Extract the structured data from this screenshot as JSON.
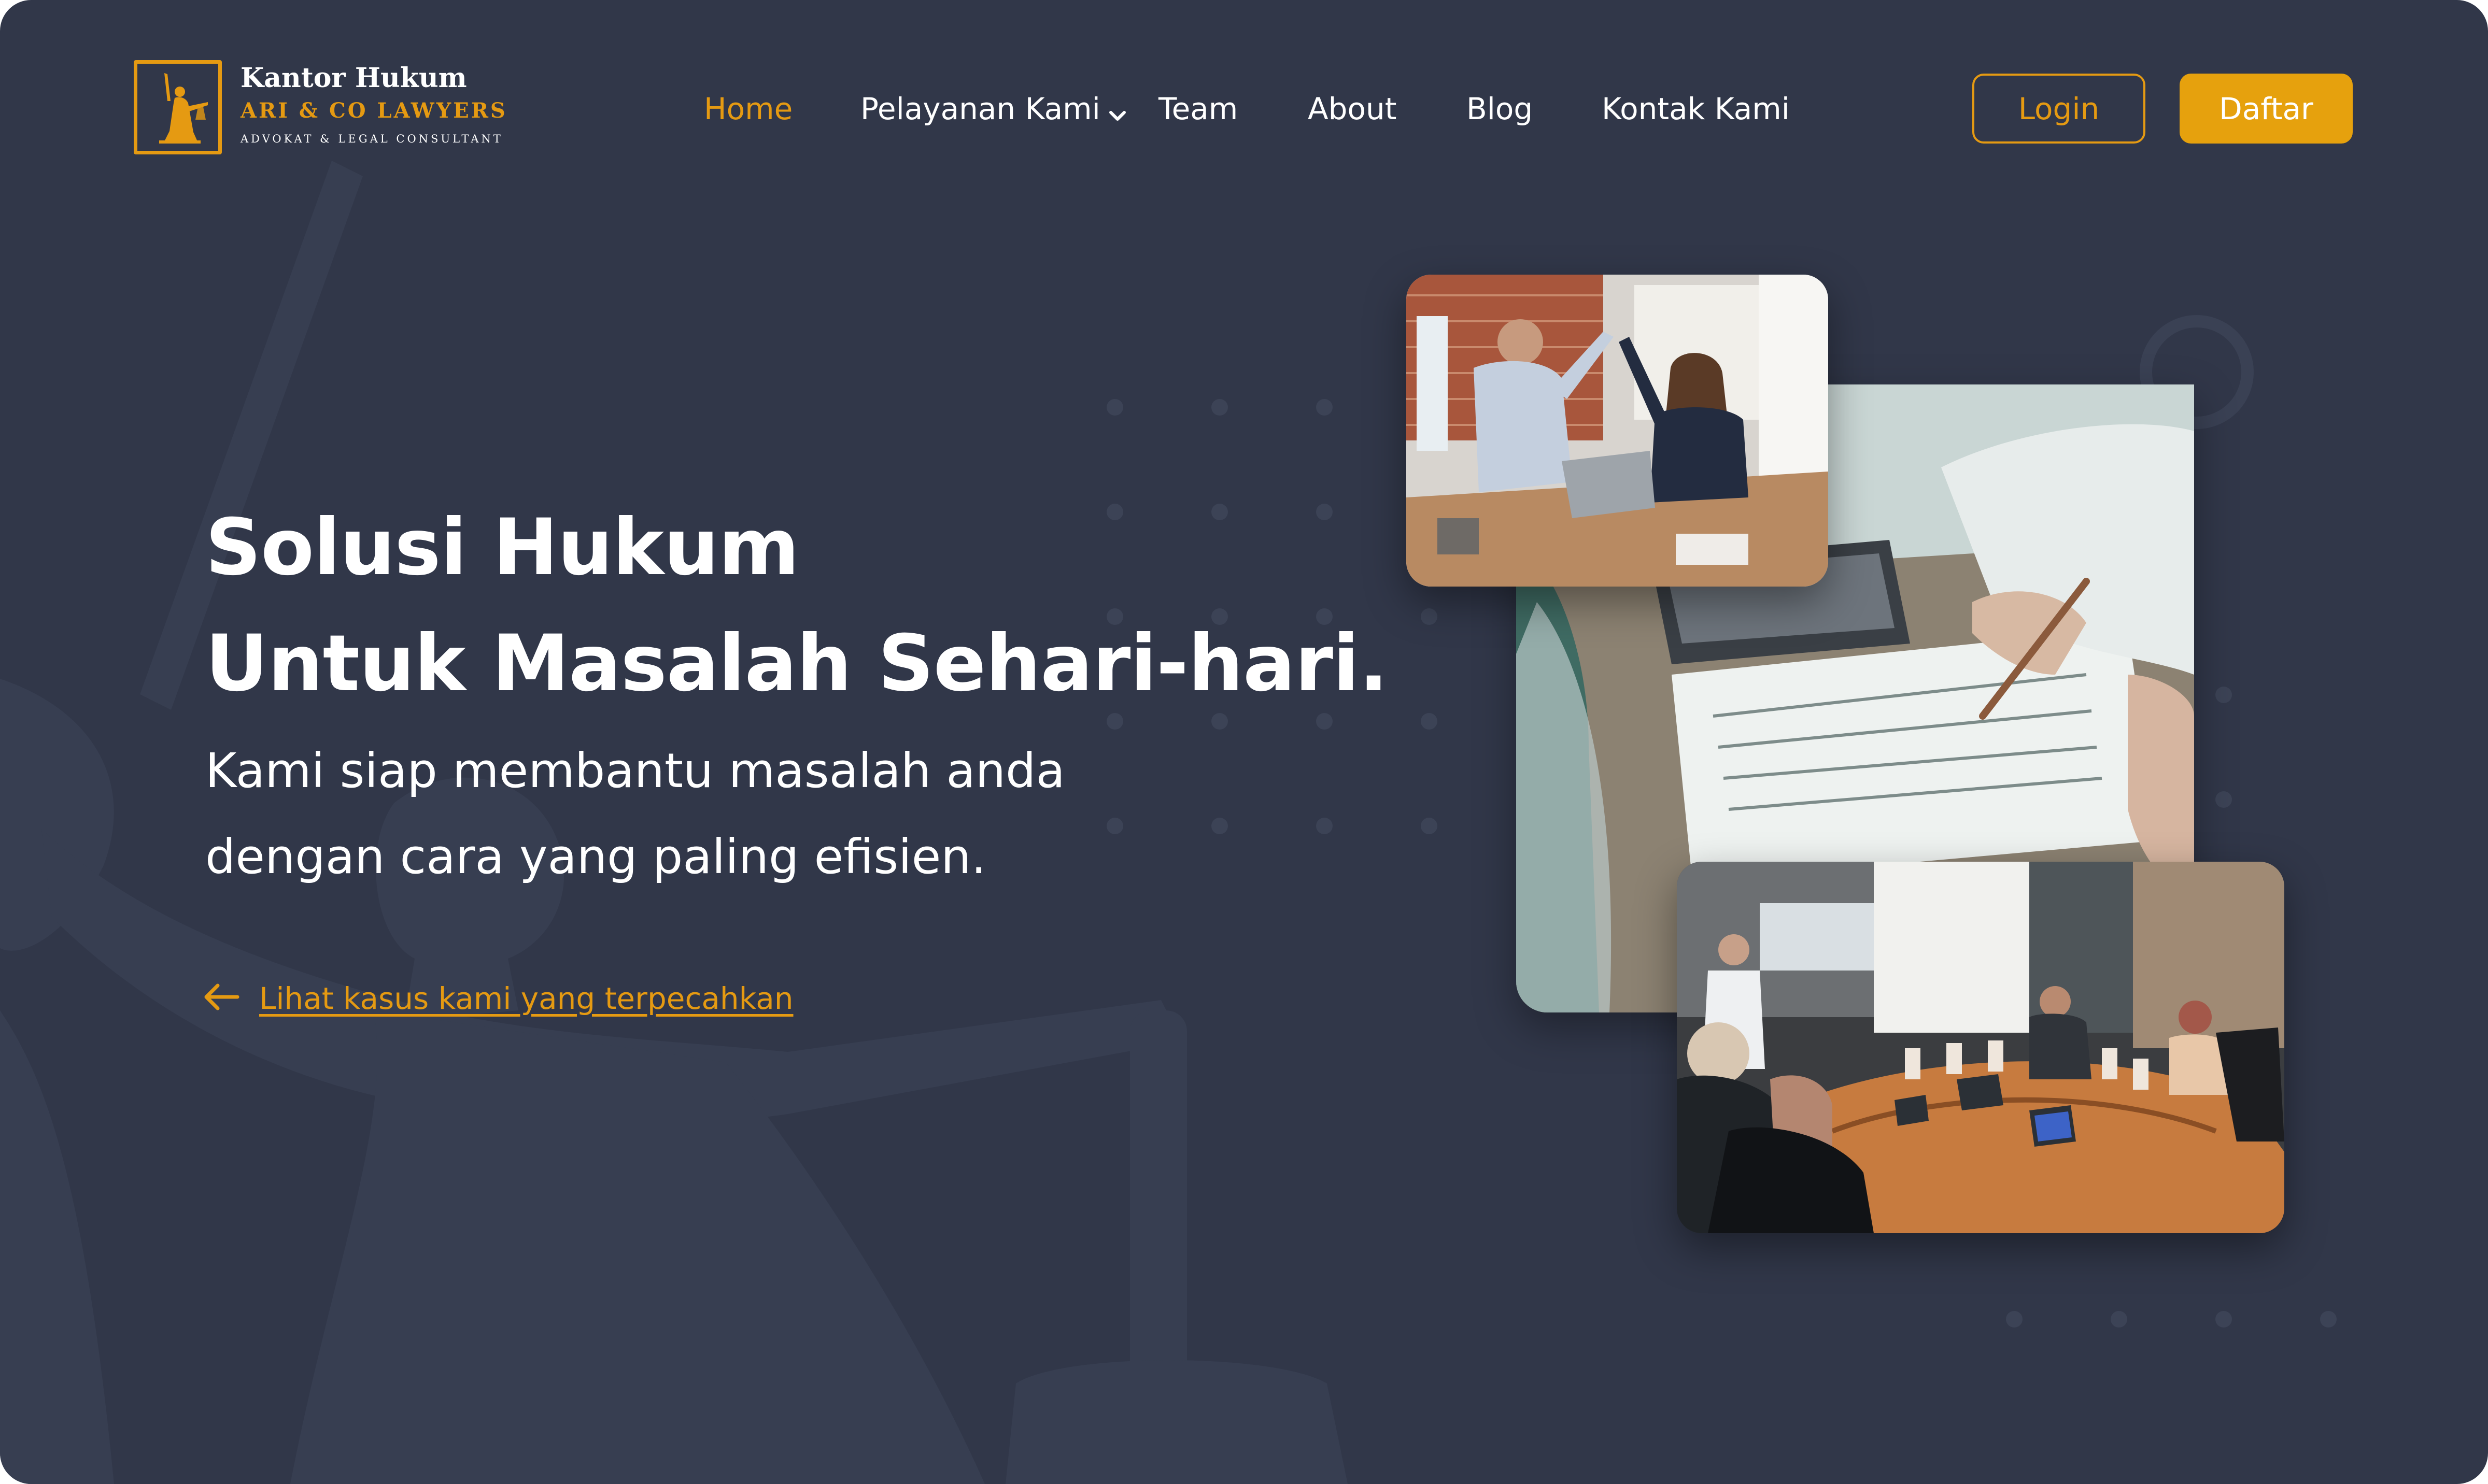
{
  "brand": {
    "line1": "Kantor Hukum",
    "line2": "ARI & CO LAWYERS",
    "line3": "ADVOKAT & LEGAL CONSULTANT"
  },
  "nav": {
    "items": [
      {
        "label": "Home",
        "active": true
      },
      {
        "label": "Pelayanan Kami",
        "has_dropdown": true
      },
      {
        "label": "Team"
      },
      {
        "label": "About"
      },
      {
        "label": "Blog"
      },
      {
        "label": "Kontak Kami"
      }
    ]
  },
  "auth": {
    "login_label": "Login",
    "register_label": "Daftar"
  },
  "hero": {
    "title_line1": "Solusi Hukum",
    "title_line2": "Untuk Masalah Sehari-hari.",
    "subtitle_line1": "Kami siap membantu masalah anda",
    "subtitle_line2": "dengan cara yang paling efisien.",
    "link_label": "Lihat kasus kami yang terpecahkan"
  },
  "icons": {
    "logo": "lady-justice-icon",
    "dropdown": "chevron-down-icon",
    "link_arrow": "arrow-left-icon"
  },
  "colors": {
    "background": "#313749",
    "accent": "#e59a12",
    "button_fill": "#e6a10d",
    "text": "#ffffff"
  }
}
